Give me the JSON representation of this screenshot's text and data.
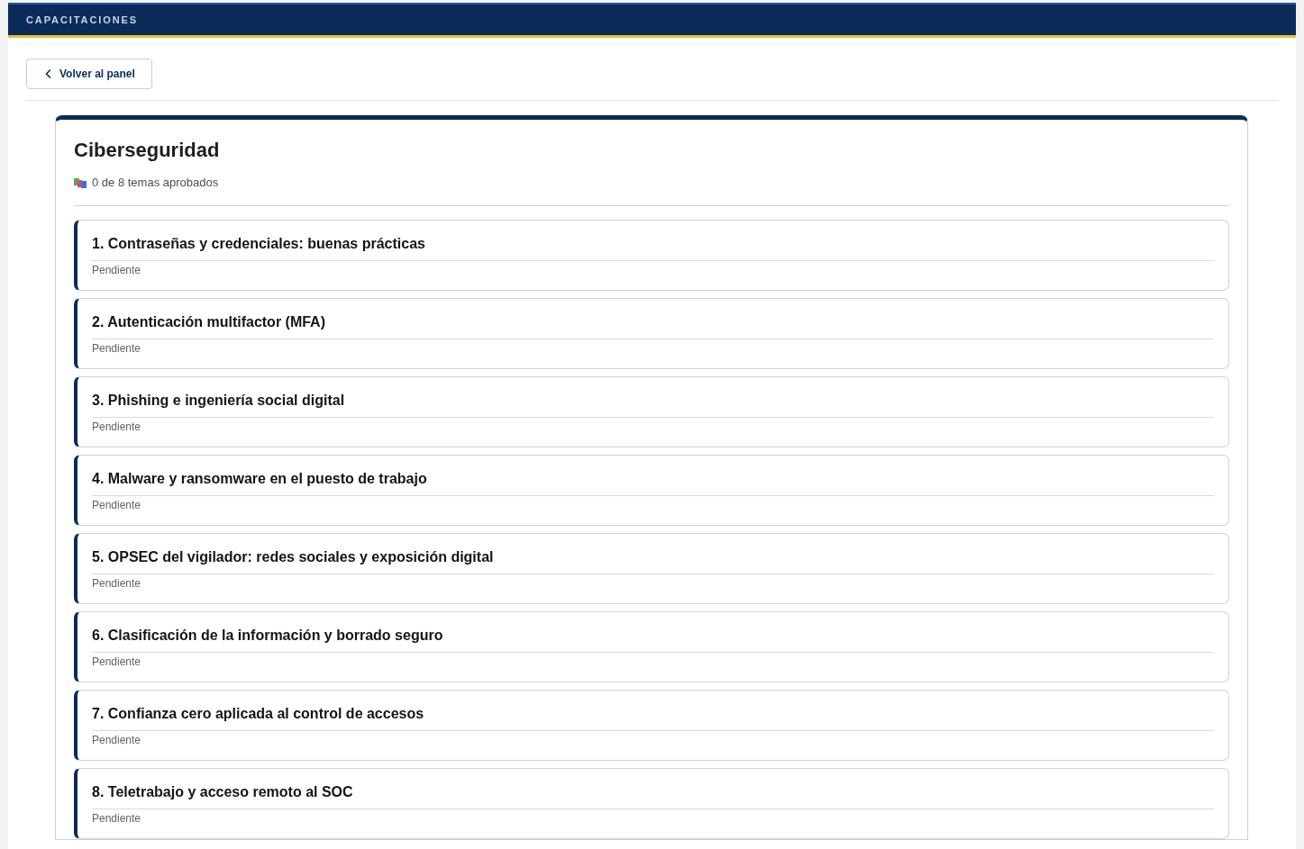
{
  "header": {
    "title": "CAPACITACIONES"
  },
  "back_button": {
    "label": "Volver al panel"
  },
  "course": {
    "title": "Ciberseguridad",
    "progress": "0 de 8 temas aprobados"
  },
  "topics": [
    {
      "title": "1. Contraseñas y credenciales: buenas prácticas",
      "status": "Pendiente"
    },
    {
      "title": "2. Autenticación multifactor (MFA)",
      "status": "Pendiente"
    },
    {
      "title": "3. Phishing e ingeniería social digital",
      "status": "Pendiente"
    },
    {
      "title": "4. Malware y ransomware en el puesto de trabajo",
      "status": "Pendiente"
    },
    {
      "title": "5. OPSEC del vigilador: redes sociales y exposición digital",
      "status": "Pendiente"
    },
    {
      "title": "6. Clasificación de la información y borrado seguro",
      "status": "Pendiente"
    },
    {
      "title": "7. Confianza cero aplicada al control de accesos",
      "status": "Pendiente"
    },
    {
      "title": "8. Teletrabajo y acceso remoto al SOC",
      "status": "Pendiente"
    }
  ]
}
